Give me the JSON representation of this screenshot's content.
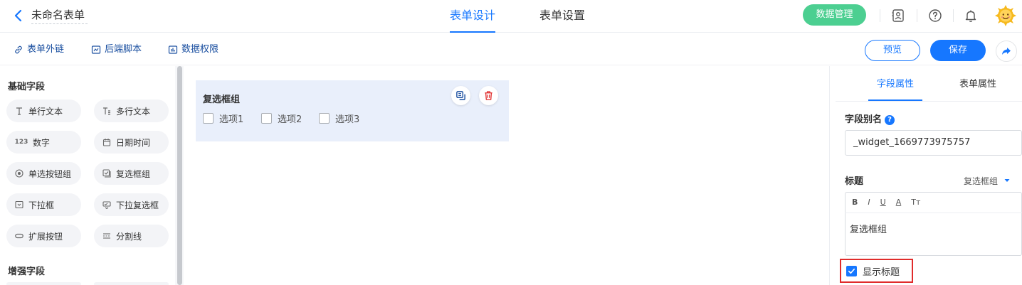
{
  "header": {
    "form_name": "未命名表单",
    "tabs": [
      {
        "label": "表单设计",
        "active": true
      },
      {
        "label": "表单设置",
        "active": false
      }
    ],
    "data_manage_button": "数据管理"
  },
  "toolbar": {
    "links": [
      {
        "label": "表单外链",
        "icon": "link-icon"
      },
      {
        "label": "后端脚本",
        "icon": "script-icon"
      },
      {
        "label": "数据权限",
        "icon": "chart-icon"
      }
    ],
    "preview_label": "预览",
    "save_label": "保存"
  },
  "palette": {
    "basic_title": "基础字段",
    "basic_fields": [
      {
        "label": "单行文本",
        "icon": "single-line-text-icon"
      },
      {
        "label": "多行文本",
        "icon": "multi-line-text-icon"
      },
      {
        "label": "数字",
        "icon": "number-icon",
        "glyph": "123"
      },
      {
        "label": "日期时间",
        "icon": "calendar-icon"
      },
      {
        "label": "单选按钮组",
        "icon": "radio-icon"
      },
      {
        "label": "复选框组",
        "icon": "checkbox-group-icon"
      },
      {
        "label": "下拉框",
        "icon": "dropdown-icon"
      },
      {
        "label": "下拉复选框",
        "icon": "dropdown-checkbox-icon"
      },
      {
        "label": "扩展按钮",
        "icon": "extend-button-icon"
      },
      {
        "label": "分割线",
        "icon": "divider-icon"
      }
    ],
    "advanced_title": "增强字段"
  },
  "canvas": {
    "widget": {
      "title": "复选框组",
      "options": [
        "选项1",
        "选项2",
        "选项3"
      ]
    }
  },
  "right_panel": {
    "tabs": [
      {
        "label": "字段属性",
        "active": true
      },
      {
        "label": "表单属性",
        "active": false
      }
    ],
    "alias_label": "字段别名",
    "alias_help": "?",
    "alias_value": "_widget_1669773975757",
    "title_label": "标题",
    "title_type": "复选框组",
    "editor_tools": [
      "B",
      "I",
      "U",
      "A",
      "Tт"
    ],
    "editor_text": "复选框组",
    "show_title_label": "显示标题",
    "show_title_checked": true
  },
  "colors": {
    "accent": "#1677ff",
    "data_button": "#4ccf91",
    "highlight_border": "#e02b2b",
    "widget_bg": "#e9effb"
  }
}
